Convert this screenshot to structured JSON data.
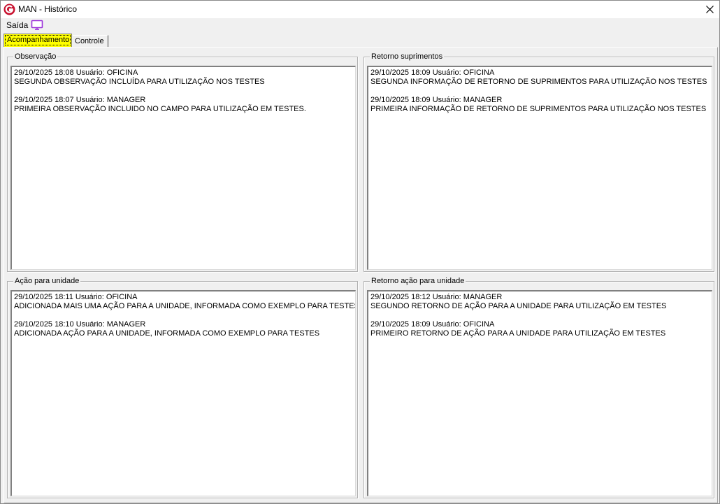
{
  "window": {
    "title": "MAN - Histórico"
  },
  "menu": {
    "saida": "Saída"
  },
  "tabs": [
    {
      "label": "Acompanhamento"
    },
    {
      "label": "Controle"
    }
  ],
  "groups": {
    "observacao": {
      "label": "Observação",
      "entries": [
        {
          "header": "29/10/2025 18:08 Usuário: OFICINA",
          "text": "SEGUNDA OBSERVAÇÃO INCLUÍDA PARA UTILIZAÇÃO NOS TESTES"
        },
        {
          "header": "29/10/2025 18:07 Usuário: MANAGER",
          "text": "PRIMEIRA OBSERVAÇÃO INCLUIDO NO CAMPO PARA UTILIZAÇÃO EM TESTES."
        }
      ]
    },
    "retorno_suprimentos": {
      "label": "Retorno suprimentos",
      "entries": [
        {
          "header": "29/10/2025 18:09 Usuário: OFICINA",
          "text": "SEGUNDA INFORMAÇÃO DE RETORNO DE SUPRIMENTOS PARA UTILIZAÇÃO NOS TESTES"
        },
        {
          "header": "29/10/2025 18:09 Usuário: MANAGER",
          "text": "PRIMEIRA INFORMAÇÃO DE RETORNO DE SUPRIMENTOS PARA UTILIZAÇÃO NOS TESTES"
        }
      ]
    },
    "acao_unidade": {
      "label": "Ação para unidade",
      "entries": [
        {
          "header": "29/10/2025 18:11 Usuário: OFICINA",
          "text": "ADICIONADA MAIS UMA AÇÃO PARA A UNIDADE, INFORMADA COMO EXEMPLO PARA TESTES"
        },
        {
          "header": "29/10/2025 18:10 Usuário: MANAGER",
          "text": "ADICIONADA AÇÃO PARA A UNIDADE, INFORMADA COMO EXEMPLO PARA TESTES"
        }
      ]
    },
    "retorno_acao_unidade": {
      "label": "Retorno ação para unidade",
      "entries": [
        {
          "header": "29/10/2025 18:12 Usuário: MANAGER",
          "text": "SEGUNDO RETORNO DE AÇÃO PARA A UNIDADE PARA UTILIZAÇÃO EM TESTES"
        },
        {
          "header": "29/10/2025 18:09 Usuário: OFICINA",
          "text": "PRIMEIRO RETORNO DE AÇÃO PARA A UNIDADE PARA UTILIZAÇÃO EM TESTES"
        }
      ]
    }
  },
  "colors": {
    "active_tab": "#ffff00",
    "app_icon": "#c8102e",
    "monitor_icon": "#9b30d9"
  },
  "icons": {
    "app": "app-logo-icon",
    "close": "close-icon",
    "monitor": "monitor-icon"
  }
}
